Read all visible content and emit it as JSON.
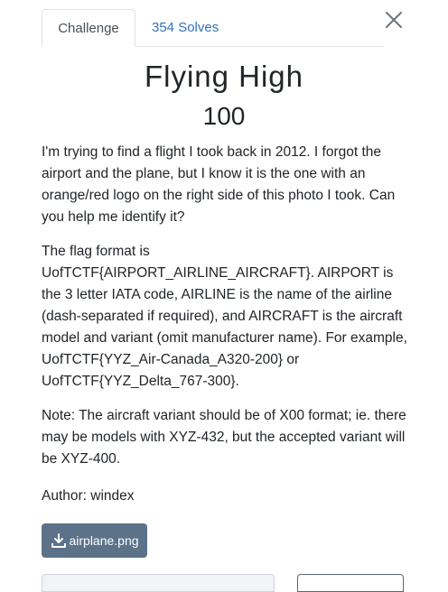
{
  "tabs": [
    {
      "label": "Challenge"
    },
    {
      "label": "354 Solves"
    }
  ],
  "challenge": {
    "title": "Flying High",
    "value": "100",
    "description": [
      "I'm trying to find a flight I took back in 2012. I forgot the airport and the plane, but I know it is the one with an orange/red logo on the right side of this photo I took. Can you help me identify it?",
      "The flag format is UofTCTF{AIRPORT_AIRLINE_AIRCRAFT}. AIRPORT is the 3 letter IATA code, AIRLINE is the name of the airline (dash-separated if required), and AIRCRAFT is the aircraft model and variant (omit manufacturer name). For example, UofTCTF{YYZ_Air-Canada_A320-200} or UofTCTF{YYZ_Delta_767-300}.",
      "Note: The aircraft variant should be of X00 format; ie. there may be models with XYZ-432, but the accepted variant will be XYZ-400."
    ],
    "author": "Author: windex",
    "attachment": "airplane.png"
  },
  "colors": {
    "link": "#2f74c0",
    "button": "#5b7289"
  },
  "icons": {
    "close": "close-icon",
    "download": "download-icon"
  }
}
